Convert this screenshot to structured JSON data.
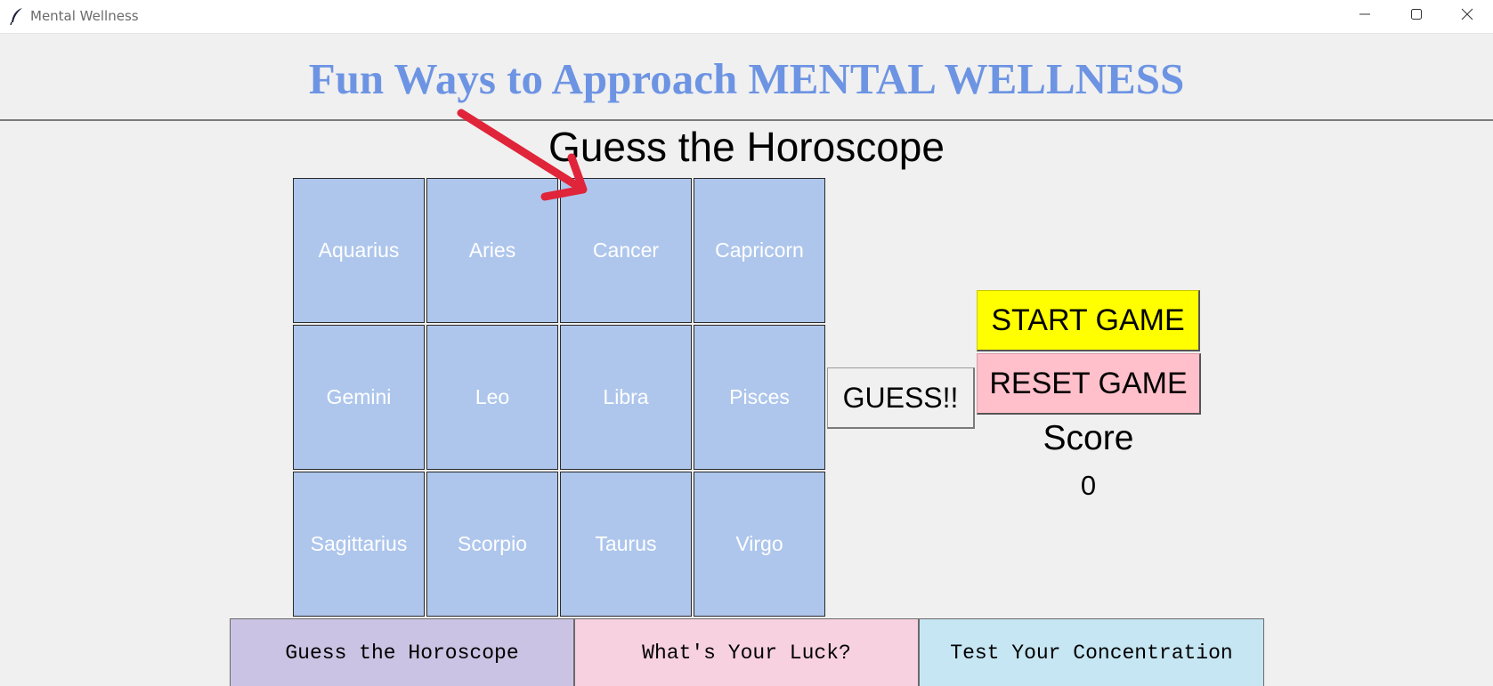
{
  "window": {
    "title": "Mental Wellness",
    "icons": {
      "app": "feather-icon",
      "minimize": "minimize-icon",
      "maximize": "maximize-icon",
      "close": "close-icon"
    }
  },
  "header": {
    "title": "Fun Ways to Approach MENTAL WELLNESS",
    "color": "#6d94e3"
  },
  "game": {
    "title": "Guess the Horoscope",
    "signs": [
      "Aquarius",
      "Aries",
      "Cancer",
      "Capricorn",
      "Gemini",
      "Leo",
      "Libra",
      "Pisces",
      "Sagittarius",
      "Scorpio",
      "Taurus",
      "Virgo"
    ],
    "cell_color": "#aec6ec",
    "guess_label": "GUESS!!",
    "start_label": "START GAME",
    "start_color": "#ffff00",
    "reset_label": "RESET GAME",
    "reset_color": "#ffc0cb",
    "score_label": "Score",
    "score_value": "0"
  },
  "nav": [
    {
      "label": "Guess the Horoscope",
      "color": "#cbc3e3"
    },
    {
      "label": "What's Your Luck?",
      "color": "#f7d1e0"
    },
    {
      "label": "Test Your Concentration",
      "color": "#c6e6f3"
    }
  ],
  "annotation": {
    "type": "arrow",
    "color": "#e0243a"
  }
}
